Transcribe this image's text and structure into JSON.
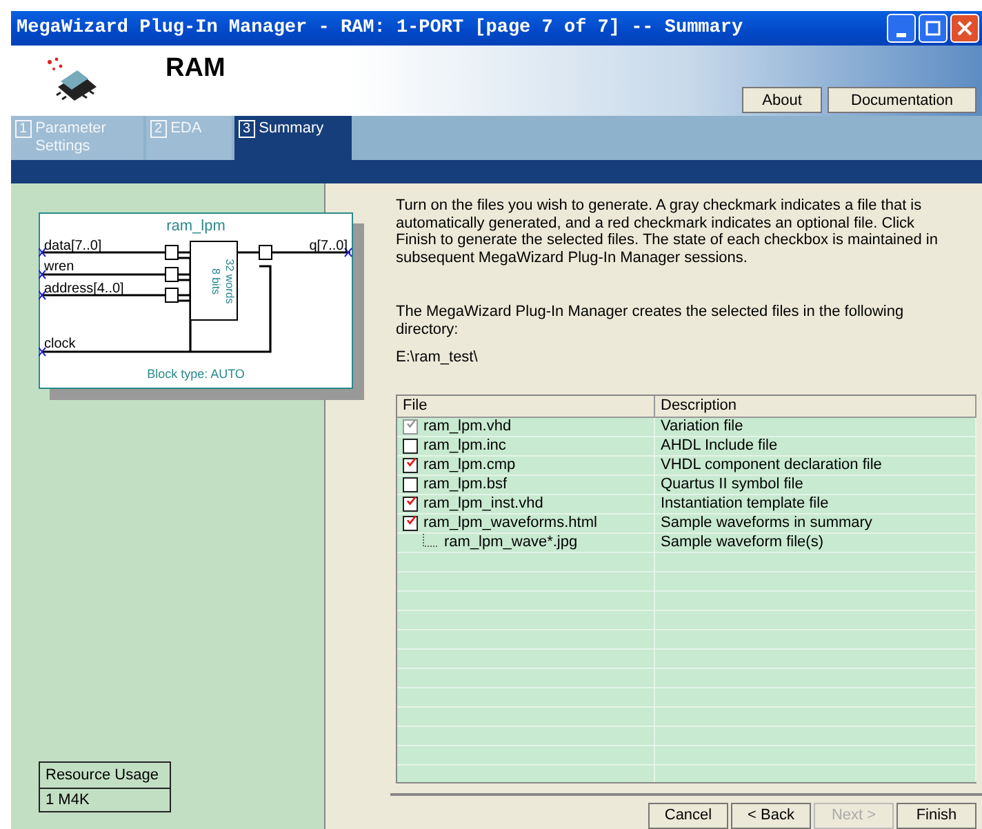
{
  "window": {
    "title": "MegaWizard Plug-In Manager - RAM: 1-PORT [page 7 of 7] -- Summary"
  },
  "header": {
    "title": "RAM",
    "buttons": [
      "About",
      "Documentation"
    ]
  },
  "tabs": [
    {
      "number": "1",
      "label": "Parameter Settings",
      "selected": false
    },
    {
      "number": "2",
      "label": "EDA",
      "selected": false
    },
    {
      "number": "3",
      "label": "Summary",
      "selected": true
    }
  ],
  "diagram": {
    "title": "ram_lpm",
    "inputs": [
      "data[7..0]",
      "wren",
      "address[4..0]"
    ],
    "clock": "clock",
    "output": "q[7..0]",
    "bits": "8 bits",
    "words": "32 words",
    "block_type": "Block type: AUTO"
  },
  "resource_usage": {
    "header": "Resource Usage",
    "value": "1 M4K"
  },
  "instructions": "Turn on the files you wish to generate. A gray checkmark indicates a file that is automatically generated, and a red checkmark indicates an optional file. Click Finish to generate the selected files. The state of each checkbox is maintained in subsequent MegaWizard Plug-In Manager sessions.",
  "directory_note": "The MegaWizard Plug-In Manager creates the selected files in the following directory:",
  "directory": "E:\\ram_test\\",
  "table": {
    "columns": [
      "File",
      "Description"
    ],
    "rows": [
      {
        "file": "ram_lpm.vhd",
        "description": "Variation file",
        "checked": true,
        "kind": "auto"
      },
      {
        "file": "ram_lpm.inc",
        "description": "AHDL Include file",
        "checked": false,
        "kind": "optional"
      },
      {
        "file": "ram_lpm.cmp",
        "description": "VHDL component declaration file",
        "checked": true,
        "kind": "optional"
      },
      {
        "file": "ram_lpm.bsf",
        "description": "Quartus II symbol file",
        "checked": false,
        "kind": "optional"
      },
      {
        "file": "ram_lpm_inst.vhd",
        "description": "Instantiation template file",
        "checked": true,
        "kind": "optional"
      },
      {
        "file": "ram_lpm_waveforms.html",
        "description": "Sample waveforms in summary",
        "checked": true,
        "kind": "optional",
        "children": [
          {
            "file": "ram_lpm_wave*.jpg",
            "description": "Sample waveform file(s)"
          }
        ]
      }
    ]
  },
  "buttons": [
    {
      "label": "Cancel",
      "disabled": false
    },
    {
      "label": "< Back",
      "disabled": false
    },
    {
      "label": "Next >",
      "disabled": true
    },
    {
      "label": "Finish",
      "disabled": false
    }
  ]
}
